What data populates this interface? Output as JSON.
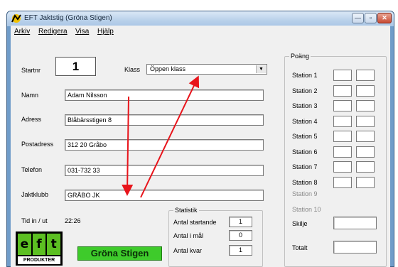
{
  "window": {
    "title": "EFT Jaktstig (Gröna Stigen)",
    "controls": {
      "minimize": "—",
      "maximize": "▫",
      "close": "✕"
    }
  },
  "menu": [
    "Arkiv",
    "Redigera",
    "Visa",
    "Hjälp"
  ],
  "form": {
    "startnr_label": "Startnr",
    "startnr_value": "1",
    "klass_label": "Klass",
    "klass_value": "Öppen klass",
    "namn_label": "Namn",
    "namn_value": "Adam Nilsson",
    "adress_label": "Adress",
    "adress_value": "Blåbärsstigen 8",
    "postadress_label": "Postadress",
    "postadress_value": "312 20 Gråbo",
    "telefon_label": "Telefon",
    "telefon_value": "031-732 33",
    "jaktklubb_label": "Jaktklubb",
    "jaktklubb_value": "GRÅBO JK",
    "tid_label": "Tid in / ut",
    "tid_value": "22:26"
  },
  "statistik": {
    "title": "Statistik",
    "rows": [
      {
        "label": "Antal startande",
        "value": "1"
      },
      {
        "label": "Antal i mål",
        "value": "0"
      },
      {
        "label": "Antal kvar",
        "value": "1"
      }
    ]
  },
  "poang": {
    "title": "Poäng",
    "stations": [
      "Station 1",
      "Station 2",
      "Station 3",
      "Station 4",
      "Station 5",
      "Station 6",
      "Station 7",
      "Station 8"
    ],
    "disabled_stations": [
      "Station 9",
      "Station 10"
    ],
    "skilje_label": "Skilje",
    "totalt_label": "Totalt"
  },
  "logo": {
    "letters": [
      "e",
      "f",
      "t"
    ],
    "subtitle": "PRODUKTER"
  },
  "banner": "Gröna Stigen",
  "colors": {
    "annotation_arrow": "#e8141b",
    "banner_green": "#3ecb2b",
    "logo_green": "#5cbf22"
  }
}
